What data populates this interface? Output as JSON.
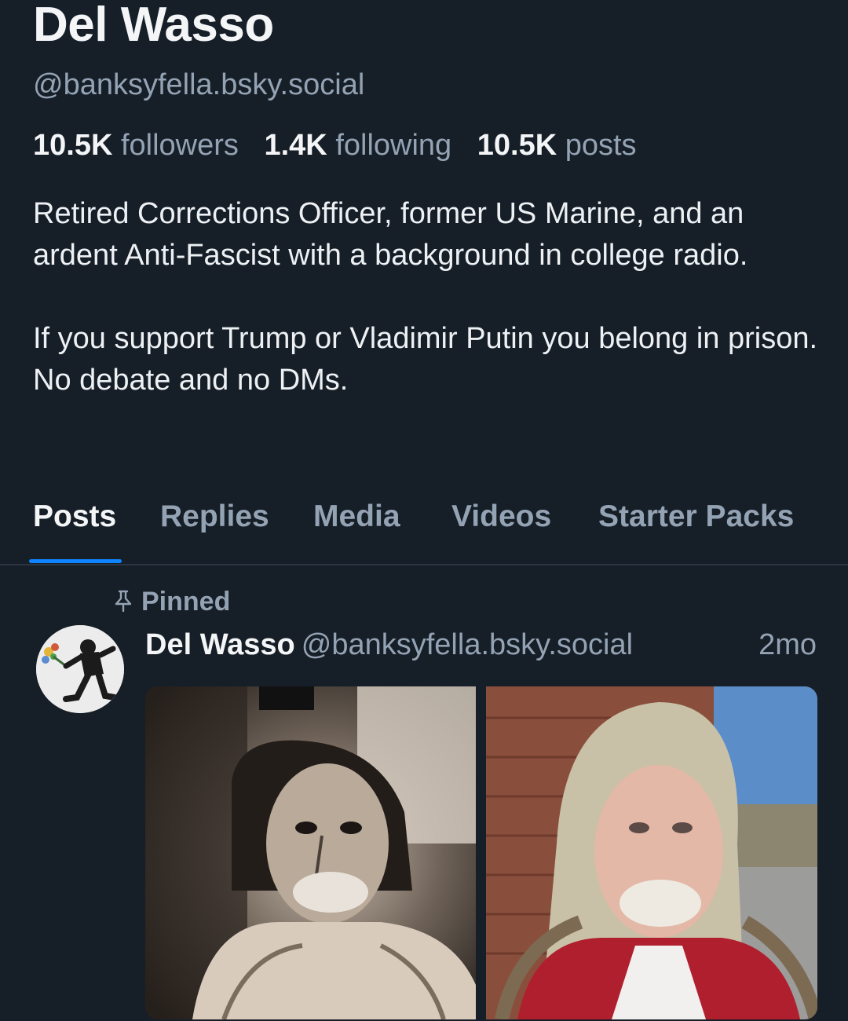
{
  "profile": {
    "display_name": "Del Wasso",
    "handle": "@banksyfella.bsky.social",
    "stats": {
      "followers_count": "10.5K",
      "followers_label": "followers",
      "following_count": "1.4K",
      "following_label": "following",
      "posts_count": "10.5K",
      "posts_label": "posts"
    },
    "bio": [
      "Retired Corrections Officer, former US Marine, and an ardent Anti-Fascist with a background in college radio.",
      "If you support Trump or Vladimir Putin you belong in prison. No debate and no DMs."
    ]
  },
  "tabs": [
    "Posts",
    "Replies",
    "Media",
    "Videos",
    "Starter Packs"
  ],
  "active_tab": "Posts",
  "pinned_post": {
    "pinned_label": "Pinned",
    "author_name": "Del Wasso",
    "author_handle": "@banksyfella.bsky.social",
    "time": "2mo",
    "images": [
      "sepia-selfie-photo",
      "outdoor-selfie-photo"
    ]
  },
  "colors": {
    "background": "#161e27",
    "primary_text": "#f3f5f7",
    "secondary_text": "#94a3b4",
    "accent": "#1083fe",
    "divider": "#2a3642"
  },
  "icons": {
    "pin": "pin-icon"
  }
}
